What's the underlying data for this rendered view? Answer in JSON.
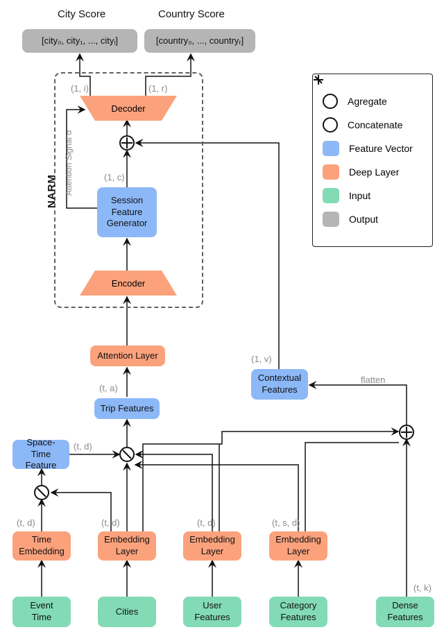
{
  "headers": {
    "city": "City Score",
    "country": "Country Score"
  },
  "outputs": {
    "city": "[city₀, city₁, ..., cityᵢ]",
    "country": "[country₀, ..., countryᵣ]"
  },
  "narm": {
    "label": "NARM",
    "decoder": "Decoder",
    "sfg": "Session\nFeature\nGenerator",
    "encoder": "Encoder",
    "attention_signal": "Attention Signal α"
  },
  "blocks": {
    "attention_layer": "Attention Layer",
    "trip_features": "Trip Features",
    "contextual_features": "Contextual\nFeatures",
    "space_time_feature": "Space-Time\nFeature",
    "time_embedding": "Time\nEmbedding",
    "embed_cities": "Embedding\nLayer",
    "embed_user": "Embedding\nLayer",
    "embed_cat": "Embedding\nLayer"
  },
  "inputs": {
    "event_time": "Event\nTime",
    "cities": "Cities",
    "user_features": "User\nFeatures",
    "category_features": "Category\nFeatures",
    "dense_features": "Dense\nFeatures"
  },
  "dims": {
    "city_out": "(1, i)",
    "country_out": "(1, r)",
    "sfg": "(1, c)",
    "ctx": "(1, v)",
    "trip": "(t, a)",
    "st": "(t, d)",
    "time": "(t, d)",
    "cities": "(t, d)",
    "user": "(t, d)",
    "cat": "(t, s, d)",
    "dense": "(t, k)",
    "flatten": "flatten"
  },
  "legend": {
    "aggregate": "Agregate",
    "concatenate": "Concatenate",
    "feature_vector": "Feature Vector",
    "deep_layer": "Deep Layer",
    "input": "Input",
    "output": "Output"
  }
}
